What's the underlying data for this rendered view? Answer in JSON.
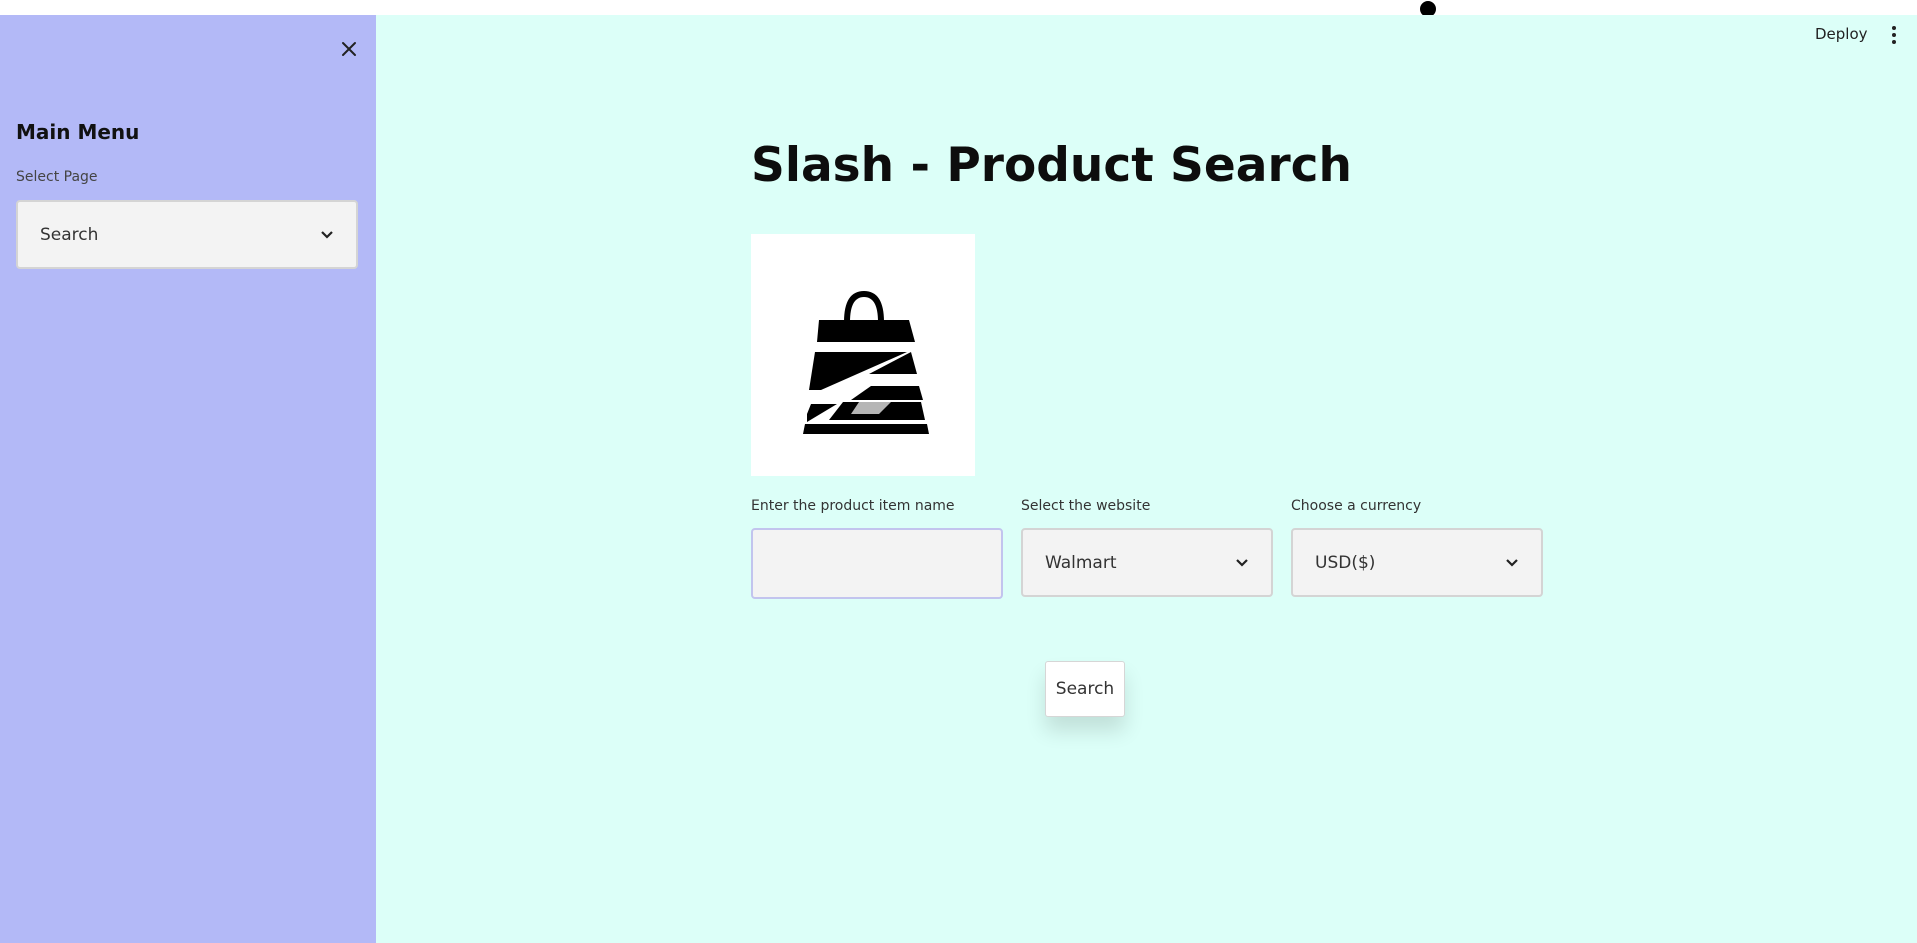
{
  "sidebar": {
    "title": "Main Menu",
    "select_label": "Select Page",
    "select_value": "Search"
  },
  "header": {
    "deploy_label": "Deploy"
  },
  "main": {
    "title": "Slash - Product Search",
    "product_label": "Enter the product item name",
    "product_value": "",
    "website_label": "Select the website",
    "website_value": "Walmart",
    "currency_label": "Choose a currency",
    "currency_value": "USD($)",
    "search_button": "Search"
  },
  "colors": {
    "sidebar_bg": "#b3b9f7",
    "main_bg": "#dcfff8"
  }
}
